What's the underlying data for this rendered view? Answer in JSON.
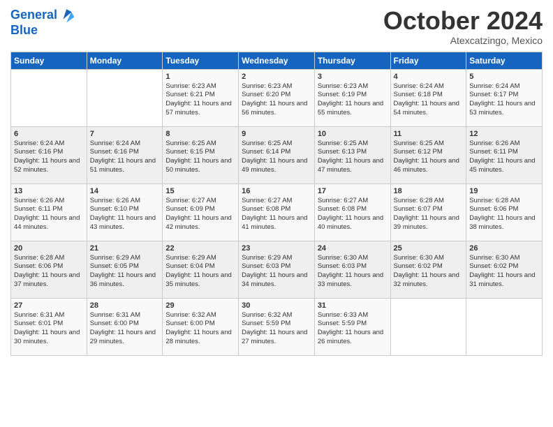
{
  "header": {
    "logo_line1": "General",
    "logo_line2": "Blue",
    "month_title": "October 2024",
    "subtitle": "Atexcatzingo, Mexico"
  },
  "days_of_week": [
    "Sunday",
    "Monday",
    "Tuesday",
    "Wednesday",
    "Thursday",
    "Friday",
    "Saturday"
  ],
  "weeks": [
    [
      {
        "day": "",
        "info": ""
      },
      {
        "day": "",
        "info": ""
      },
      {
        "day": "1",
        "info": "Sunrise: 6:23 AM\nSunset: 6:21 PM\nDaylight: 11 hours and 57 minutes."
      },
      {
        "day": "2",
        "info": "Sunrise: 6:23 AM\nSunset: 6:20 PM\nDaylight: 11 hours and 56 minutes."
      },
      {
        "day": "3",
        "info": "Sunrise: 6:23 AM\nSunset: 6:19 PM\nDaylight: 11 hours and 55 minutes."
      },
      {
        "day": "4",
        "info": "Sunrise: 6:24 AM\nSunset: 6:18 PM\nDaylight: 11 hours and 54 minutes."
      },
      {
        "day": "5",
        "info": "Sunrise: 6:24 AM\nSunset: 6:17 PM\nDaylight: 11 hours and 53 minutes."
      }
    ],
    [
      {
        "day": "6",
        "info": "Sunrise: 6:24 AM\nSunset: 6:16 PM\nDaylight: 11 hours and 52 minutes."
      },
      {
        "day": "7",
        "info": "Sunrise: 6:24 AM\nSunset: 6:16 PM\nDaylight: 11 hours and 51 minutes."
      },
      {
        "day": "8",
        "info": "Sunrise: 6:25 AM\nSunset: 6:15 PM\nDaylight: 11 hours and 50 minutes."
      },
      {
        "day": "9",
        "info": "Sunrise: 6:25 AM\nSunset: 6:14 PM\nDaylight: 11 hours and 49 minutes."
      },
      {
        "day": "10",
        "info": "Sunrise: 6:25 AM\nSunset: 6:13 PM\nDaylight: 11 hours and 47 minutes."
      },
      {
        "day": "11",
        "info": "Sunrise: 6:25 AM\nSunset: 6:12 PM\nDaylight: 11 hours and 46 minutes."
      },
      {
        "day": "12",
        "info": "Sunrise: 6:26 AM\nSunset: 6:11 PM\nDaylight: 11 hours and 45 minutes."
      }
    ],
    [
      {
        "day": "13",
        "info": "Sunrise: 6:26 AM\nSunset: 6:11 PM\nDaylight: 11 hours and 44 minutes."
      },
      {
        "day": "14",
        "info": "Sunrise: 6:26 AM\nSunset: 6:10 PM\nDaylight: 11 hours and 43 minutes."
      },
      {
        "day": "15",
        "info": "Sunrise: 6:27 AM\nSunset: 6:09 PM\nDaylight: 11 hours and 42 minutes."
      },
      {
        "day": "16",
        "info": "Sunrise: 6:27 AM\nSunset: 6:08 PM\nDaylight: 11 hours and 41 minutes."
      },
      {
        "day": "17",
        "info": "Sunrise: 6:27 AM\nSunset: 6:08 PM\nDaylight: 11 hours and 40 minutes."
      },
      {
        "day": "18",
        "info": "Sunrise: 6:28 AM\nSunset: 6:07 PM\nDaylight: 11 hours and 39 minutes."
      },
      {
        "day": "19",
        "info": "Sunrise: 6:28 AM\nSunset: 6:06 PM\nDaylight: 11 hours and 38 minutes."
      }
    ],
    [
      {
        "day": "20",
        "info": "Sunrise: 6:28 AM\nSunset: 6:06 PM\nDaylight: 11 hours and 37 minutes."
      },
      {
        "day": "21",
        "info": "Sunrise: 6:29 AM\nSunset: 6:05 PM\nDaylight: 11 hours and 36 minutes."
      },
      {
        "day": "22",
        "info": "Sunrise: 6:29 AM\nSunset: 6:04 PM\nDaylight: 11 hours and 35 minutes."
      },
      {
        "day": "23",
        "info": "Sunrise: 6:29 AM\nSunset: 6:03 PM\nDaylight: 11 hours and 34 minutes."
      },
      {
        "day": "24",
        "info": "Sunrise: 6:30 AM\nSunset: 6:03 PM\nDaylight: 11 hours and 33 minutes."
      },
      {
        "day": "25",
        "info": "Sunrise: 6:30 AM\nSunset: 6:02 PM\nDaylight: 11 hours and 32 minutes."
      },
      {
        "day": "26",
        "info": "Sunrise: 6:30 AM\nSunset: 6:02 PM\nDaylight: 11 hours and 31 minutes."
      }
    ],
    [
      {
        "day": "27",
        "info": "Sunrise: 6:31 AM\nSunset: 6:01 PM\nDaylight: 11 hours and 30 minutes."
      },
      {
        "day": "28",
        "info": "Sunrise: 6:31 AM\nSunset: 6:00 PM\nDaylight: 11 hours and 29 minutes."
      },
      {
        "day": "29",
        "info": "Sunrise: 6:32 AM\nSunset: 6:00 PM\nDaylight: 11 hours and 28 minutes."
      },
      {
        "day": "30",
        "info": "Sunrise: 6:32 AM\nSunset: 5:59 PM\nDaylight: 11 hours and 27 minutes."
      },
      {
        "day": "31",
        "info": "Sunrise: 6:33 AM\nSunset: 5:59 PM\nDaylight: 11 hours and 26 minutes."
      },
      {
        "day": "",
        "info": ""
      },
      {
        "day": "",
        "info": ""
      }
    ]
  ]
}
